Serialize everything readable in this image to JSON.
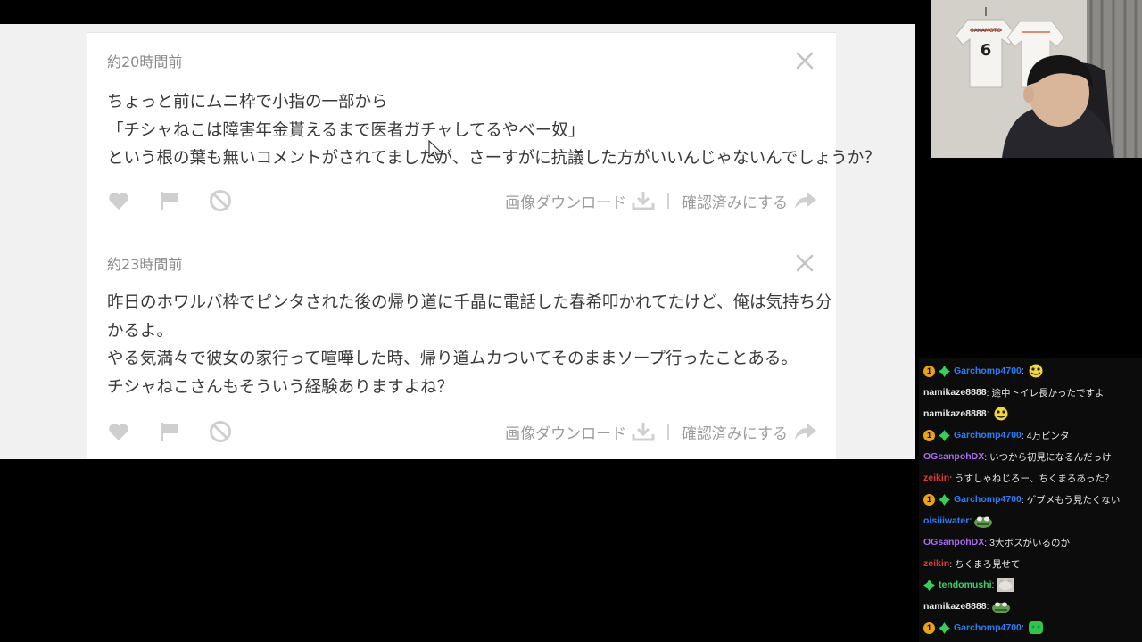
{
  "comments": [
    {
      "time": "約20時間前",
      "lines": [
        "ちょっと前にムニ枠で小指の一部から",
        "「チシャねこは障害年金貰えるまで医者ガチャしてるやべー奴」",
        "という根の葉も無いコメントがされてましたが、さーすがに抗議した方がいいんじゃないんでしょうか？"
      ],
      "download_label": "画像ダウンロード",
      "confirm_label": "確認済みにする"
    },
    {
      "time": "約23時間前",
      "lines": [
        "昨日のホワルバ枠でピンタされた後の帰り道に千晶に電話した春希叩かれてたけど、俺は気持ち分",
        "かるよ。",
        "やる気満々で彼女の家行って喧嘩した時、帰り道ムカついてそのままソープ行ったことある。",
        "チシャねこさんもそういう経験ありますよね？"
      ],
      "download_label": "画像ダウンロード",
      "confirm_label": "確認済みにする"
    }
  ],
  "webcam": {
    "jersey_name": "SAKAMOTO",
    "jersey_number": "6"
  },
  "chat": {
    "messages": [
      {
        "user": "Garchomp4700",
        "color": "#2e7cf6",
        "badges": [
          "sub",
          "gem"
        ],
        "text": "",
        "emote": "yellow-emote"
      },
      {
        "user": "namikaze8888",
        "color": "#e8e8e8",
        "badges": [],
        "text": "途中トイレ長かったですよ",
        "emote": ""
      },
      {
        "user": "namikaze8888",
        "color": "#e8e8e8",
        "badges": [],
        "text": "",
        "emote": "yellow-emote"
      },
      {
        "user": "Garchomp4700",
        "color": "#2e7cf6",
        "badges": [
          "sub",
          "gem"
        ],
        "text": "4万ピンタ",
        "emote": ""
      },
      {
        "user": "OGsanpohDX",
        "color": "#a86cf0",
        "badges": [],
        "text": "いつから初見になるんだっけ",
        "emote": ""
      },
      {
        "user": "zeikin",
        "color": "#e0383e",
        "badges": [],
        "text": "うすしゃねじろー、ちくまろあった？",
        "emote": ""
      },
      {
        "user": "Garchomp4700",
        "color": "#2e7cf6",
        "badges": [
          "sub",
          "gem"
        ],
        "text": "ゲブメもう見たくない",
        "emote": ""
      },
      {
        "user": "oisiiiwater",
        "color": "#2e7cf6",
        "badges": [],
        "text": "",
        "emote": "frog-emote"
      },
      {
        "user": "OGsanpohDX",
        "color": "#a86cf0",
        "badges": [],
        "text": "3大ボスがいるのか",
        "emote": ""
      },
      {
        "user": "zeikin",
        "color": "#e0383e",
        "badges": [],
        "text": "ちくまろ見せて",
        "emote": ""
      },
      {
        "user": "tendomushi",
        "color": "#3ad06b",
        "badges": [
          "gem"
        ],
        "text": "",
        "emote": "cat-emote"
      },
      {
        "user": "namikaze8888",
        "color": "#e8e8e8",
        "badges": [],
        "text": "",
        "emote": "frog-emote"
      },
      {
        "user": "Garchomp4700",
        "color": "#2e7cf6",
        "badges": [
          "sub",
          "gem"
        ],
        "text": "",
        "emote": "green-emote"
      }
    ]
  }
}
